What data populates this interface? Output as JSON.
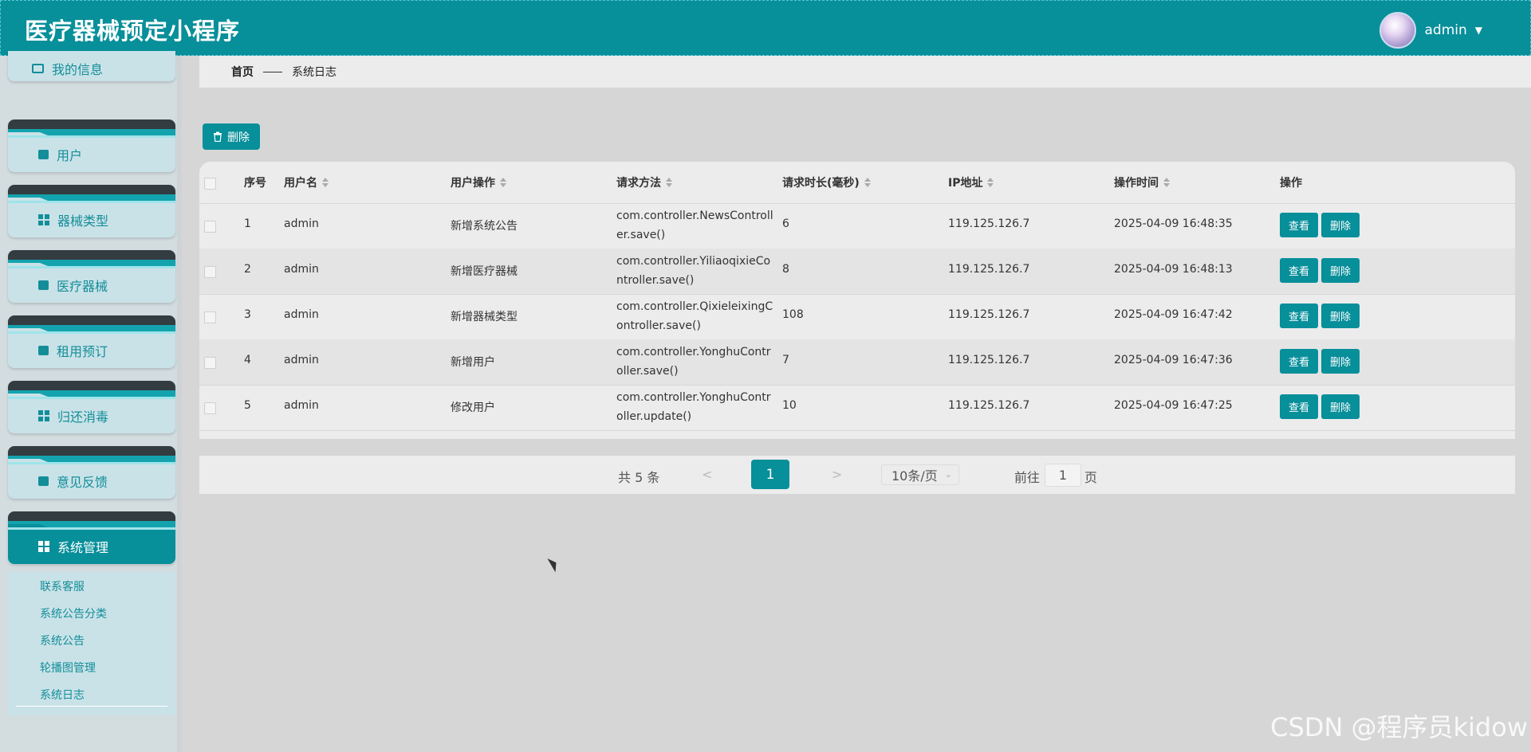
{
  "app": {
    "title": "医疗器械预定小程序",
    "user": "admin",
    "accent": "#078f9a"
  },
  "sidebar": {
    "partial_item": "我的信息",
    "items": [
      {
        "label": "用户",
        "icon": "chat-icon"
      },
      {
        "label": "器械类型",
        "icon": "grid-icon"
      },
      {
        "label": "医疗器械",
        "icon": "briefcase-icon"
      },
      {
        "label": "租用预订",
        "icon": "clipboard-icon"
      },
      {
        "label": "归还消毒",
        "icon": "grid-icon"
      },
      {
        "label": "意见反馈",
        "icon": "clipboard-check-icon"
      },
      {
        "label": "系统管理",
        "icon": "grid-icon",
        "active": true
      }
    ],
    "submenu": [
      "联系客服",
      "系统公告分类",
      "系统公告",
      "轮播图管理",
      "系统日志"
    ]
  },
  "breadcrumb": {
    "home": "首页",
    "current": "系统日志"
  },
  "toolbar": {
    "delete_label": "删除"
  },
  "table": {
    "headers": {
      "index": "序号",
      "username": "用户名",
      "operation": "用户操作",
      "method": "请求方法",
      "duration": "请求时长(毫秒)",
      "ip": "IP地址",
      "time": "操作时间",
      "actions": "操作"
    },
    "rows": [
      {
        "index": "1",
        "username": "admin",
        "operation": "新增系统公告",
        "method": "com.controller.NewsController.save()",
        "duration": "6",
        "ip": "119.125.126.7",
        "time": "2025-04-09 16:48:35"
      },
      {
        "index": "2",
        "username": "admin",
        "operation": "新增医疗器械",
        "method": "com.controller.YiliaoqixieController.save()",
        "duration": "8",
        "ip": "119.125.126.7",
        "time": "2025-04-09 16:48:13"
      },
      {
        "index": "3",
        "username": "admin",
        "operation": "新增器械类型",
        "method": "com.controller.QixieleixingController.save()",
        "duration": "108",
        "ip": "119.125.126.7",
        "time": "2025-04-09 16:47:42"
      },
      {
        "index": "4",
        "username": "admin",
        "operation": "新增用户",
        "method": "com.controller.YonghuController.save()",
        "duration": "7",
        "ip": "119.125.126.7",
        "time": "2025-04-09 16:47:36"
      },
      {
        "index": "5",
        "username": "admin",
        "operation": "修改用户",
        "method": "com.controller.YonghuController.update()",
        "duration": "10",
        "ip": "119.125.126.7",
        "time": "2025-04-09 16:47:25"
      }
    ],
    "view_label": "查看",
    "delete_label": "删除"
  },
  "pagination": {
    "total": "共 5 条",
    "prev": "<",
    "page": "1",
    "next": ">",
    "page_size": "10条/页",
    "goto": "前往",
    "goto_value": "1",
    "unit": "页"
  },
  "watermark": "CSDN @程序员kidow"
}
